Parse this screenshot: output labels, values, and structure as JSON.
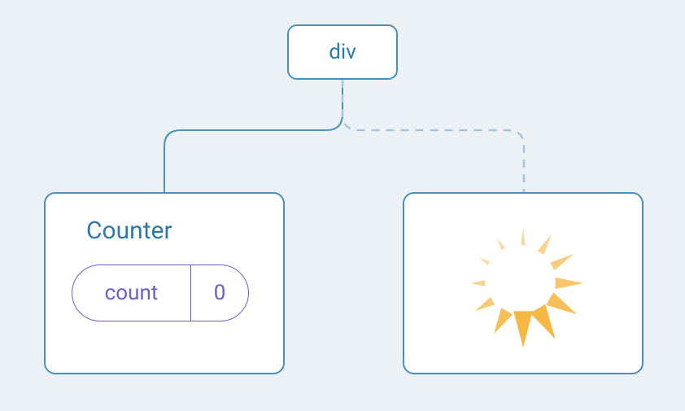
{
  "root": {
    "label": "div"
  },
  "counter": {
    "title": "Counter",
    "pill_label": "count",
    "pill_value": "0"
  }
}
